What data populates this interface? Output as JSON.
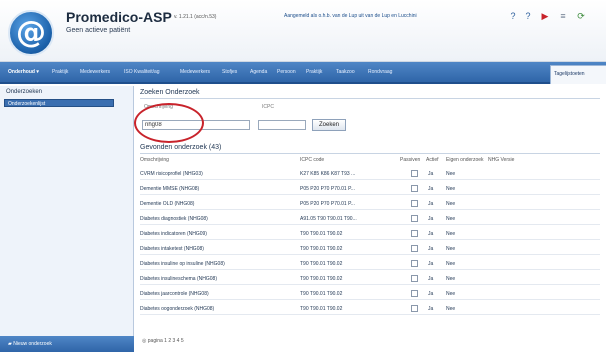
{
  "app": {
    "title": "Promedico-ASP",
    "patient_status": "Geen actieve patiënt",
    "version": "v. 1.21.1 (acc/n.53)",
    "user_links": "Aangemeld als o.h.b. van de Lup uit van de Lup en Lucchini"
  },
  "header_icons": [
    "help-icon",
    "question-icon",
    "forward-icon",
    "list-icon",
    "refresh-icon"
  ],
  "nav": {
    "items": [
      "Onderhoud ▾",
      "Praktijk",
      "Medewerkers",
      "ISO Kwaliteit/ag",
      "Medewerkers",
      "Stofjes",
      "Agenda",
      "Persoon",
      "Praktijk",
      "Taakzoo",
      "Rondvraag"
    ],
    "active_tab": "Tagelijstoeten"
  },
  "sidebar": {
    "heading": "Onderzoeken",
    "selected_item": "Onderzoekenlijst",
    "bottom_button": "Nieuw onderzoek"
  },
  "search": {
    "title": "Zoeken Onderzoek",
    "label_omschrijving": "Omschrijving",
    "label_icpc": "ICPC",
    "omschrijving_value": "nhg08",
    "icpc_value": "",
    "button_label": "Zoeken"
  },
  "results": {
    "title": "Gevonden onderzoek (43)",
    "columns": [
      "Omschrijving",
      "ICPC code",
      "Passiven",
      "Actief",
      "Eigen onderzoek",
      "NHG Versie"
    ],
    "rows": [
      {
        "omschrijving": "CVRM risicoprofiel (NHG03)",
        "icpc": "K27 K85 K86 K87 T93 ...",
        "actief": "Ja",
        "eigen": "Nee"
      },
      {
        "omschrijving": "Dementie MMSE (NHG08)",
        "icpc": "P05 P20 P70 P70.01 P...",
        "actief": "Ja",
        "eigen": "Nee"
      },
      {
        "omschrijving": "Dementie OLD (NHG08)",
        "icpc": "P05 P20 P70 P70.01 P...",
        "actief": "Ja",
        "eigen": "Nee"
      },
      {
        "omschrijving": "Diabetes diagnostiek (NHG08)",
        "icpc": "A91.05 T90 T90.01 T90...",
        "actief": "Ja",
        "eigen": "Nee"
      },
      {
        "omschrijving": "Diabetes indicatoren (NHG09)",
        "icpc": "T90 T90.01 T90.02",
        "actief": "Ja",
        "eigen": "Nee"
      },
      {
        "omschrijving": "Diabetes intaketest (NHG08)",
        "icpc": "T90 T90.01 T90.02",
        "actief": "Ja",
        "eigen": "Nee"
      },
      {
        "omschrijving": "Diabetes insuline op insuline (NHG08)",
        "icpc": "T90 T90.01 T90.02",
        "actief": "Ja",
        "eigen": "Nee"
      },
      {
        "omschrijving": "Diabetes insulineschema (NHG08)",
        "icpc": "T90 T90.01 T90.02",
        "actief": "Ja",
        "eigen": "Nee"
      },
      {
        "omschrijving": "Diabetes jaarcontrole (NHG08)",
        "icpc": "T90 T90.01 T90.02",
        "actief": "Ja",
        "eigen": "Nee"
      },
      {
        "omschrijving": "Diabetes oogonderzoek (NHG08)",
        "icpc": "T90 T90.01 T90.02",
        "actief": "Ja",
        "eigen": "Nee"
      }
    ]
  },
  "pager": {
    "text": "pagina 1 2 3 4 5"
  },
  "colors": {
    "nav_blue": "#2f65a8",
    "highlight_circle": "#c8232b",
    "sidebar_bg": "#eef3fa"
  }
}
